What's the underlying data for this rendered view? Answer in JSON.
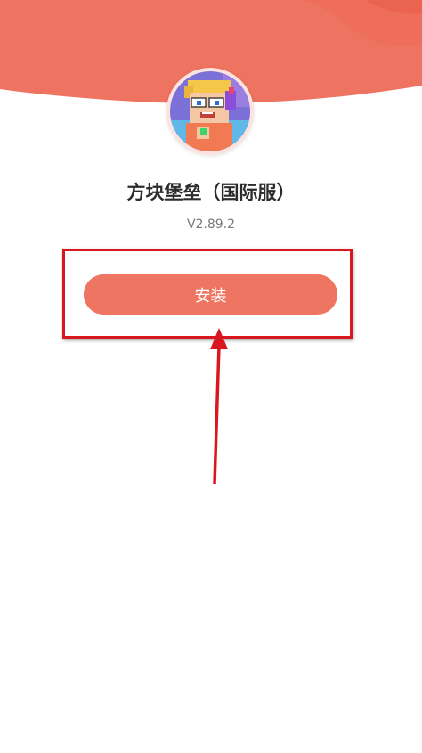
{
  "app": {
    "name": "方块堡垒（国际服）",
    "version": "V2.89.2",
    "icon": "blockman-avatar-icon"
  },
  "actions": {
    "install_label": "安装"
  },
  "colors": {
    "header": "#ef7361",
    "button": "#ee7562",
    "highlight": "#d9171e"
  }
}
